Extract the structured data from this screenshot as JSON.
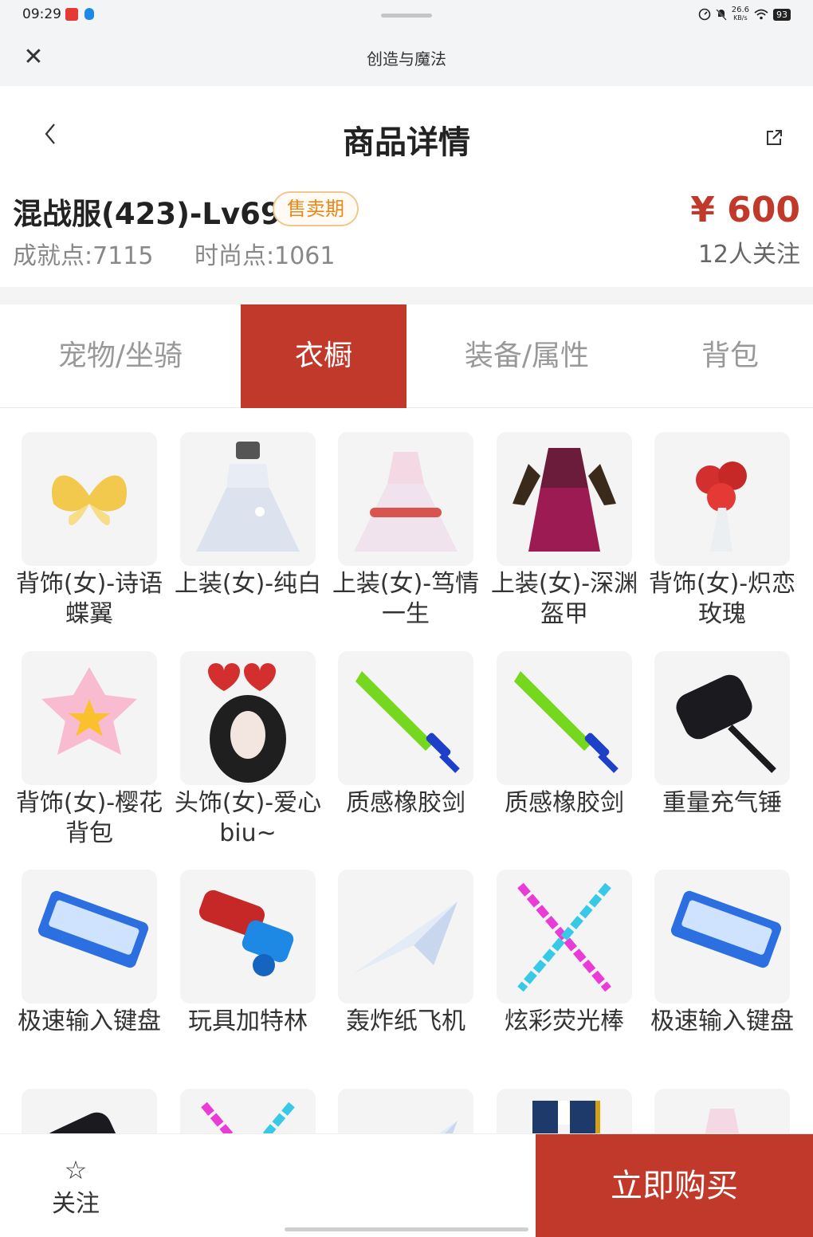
{
  "status_bar": {
    "time": "09:29",
    "net_speed_value": "26.6",
    "net_speed_unit": "KB/s",
    "battery": "93"
  },
  "title_bar": {
    "close_icon": "close-icon",
    "title": "创造与魔法"
  },
  "page_header": {
    "title": "商品详情",
    "back_icon": "chevron-left-icon",
    "share_icon": "share-icon"
  },
  "product": {
    "name": "混战服(423)-Lv69",
    "badge": "售卖期",
    "achievement": "成就点:7115",
    "fashion": "时尚点:1061",
    "price": "¥ 600",
    "followers": "12人关注"
  },
  "tabs": [
    {
      "label": "宠物/坐骑",
      "active": false
    },
    {
      "label": "衣橱",
      "active": true
    },
    {
      "label": "装备/属性",
      "active": false
    },
    {
      "label": "背包",
      "active": false
    }
  ],
  "items": [
    {
      "label": "背饰(女)-诗语蝶翼",
      "icon": "butterfly-wings-icon"
    },
    {
      "label": "上装(女)-纯白",
      "icon": "white-dress-icon"
    },
    {
      "label": "上装(女)-笃情一生",
      "icon": "wedding-dress-icon"
    },
    {
      "label": "上装(女)-深渊盔甲",
      "icon": "abyss-armor-icon"
    },
    {
      "label": "背饰(女)-炽恋玫瑰",
      "icon": "rose-bouquet-icon"
    },
    {
      "label": "背饰(女)-樱花背包",
      "icon": "sakura-backpack-icon"
    },
    {
      "label": "头饰(女)-爱心biu~",
      "icon": "heart-headband-icon"
    },
    {
      "label": "质感橡胶剑",
      "icon": "rubber-sword-icon"
    },
    {
      "label": "质感橡胶剑",
      "icon": "rubber-sword-icon"
    },
    {
      "label": "重量充气锤",
      "icon": "inflatable-hammer-icon"
    },
    {
      "label": "极速输入键盘",
      "icon": "keyboard-icon"
    },
    {
      "label": "玩具加特林",
      "icon": "toy-gatling-icon"
    },
    {
      "label": "轰炸纸飞机",
      "icon": "paper-plane-icon"
    },
    {
      "label": "炫彩荧光棒",
      "icon": "glow-sticks-icon"
    },
    {
      "label": "极速输入键盘",
      "icon": "keyboard-icon"
    },
    {
      "label": "",
      "icon": "inflatable-hammer-icon"
    },
    {
      "label": "",
      "icon": "glow-sticks-icon"
    },
    {
      "label": "",
      "icon": "paper-plane-icon"
    },
    {
      "label": "",
      "icon": "jeans-icon"
    },
    {
      "label": "",
      "icon": "wedding-dress-icon"
    }
  ],
  "bottom_bar": {
    "follow_label": "关注",
    "follow_icon": "star-outline-icon",
    "buy_label": "立即购买"
  },
  "colors": {
    "accent": "#c0392b",
    "badge_text": "#e8881a",
    "badge_border": "#f0c78f"
  }
}
